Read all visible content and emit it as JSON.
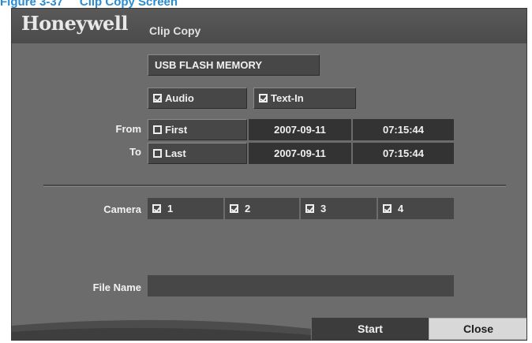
{
  "caption": "Figure 3-37     Clip Copy Screen",
  "header": {
    "brand": "Honeywell",
    "title": "Clip Copy"
  },
  "device": {
    "value": "USB FLASH MEMORY"
  },
  "options": [
    {
      "label": "Audio",
      "checked": true
    },
    {
      "label": "Text-In",
      "checked": true
    }
  ],
  "range": {
    "from_label": "From",
    "to_label": "To",
    "from": {
      "option": "First",
      "checked": false,
      "date": "2007-09-11",
      "time": "07:15:44"
    },
    "to": {
      "option": "Last",
      "checked": false,
      "date": "2007-09-11",
      "time": "07:15:44"
    }
  },
  "camera": {
    "label": "Camera",
    "items": [
      {
        "label": "1",
        "checked": true
      },
      {
        "label": "2",
        "checked": true
      },
      {
        "label": "3",
        "checked": true
      },
      {
        "label": "4",
        "checked": true
      }
    ]
  },
  "file_name": {
    "label": "File Name",
    "value": ""
  },
  "buttons": {
    "start": "Start",
    "close": "Close"
  },
  "colors": {
    "panel": "#6c6c6c",
    "field": "#474747",
    "field_dark": "#333333",
    "caption": "#2a8bd0"
  }
}
